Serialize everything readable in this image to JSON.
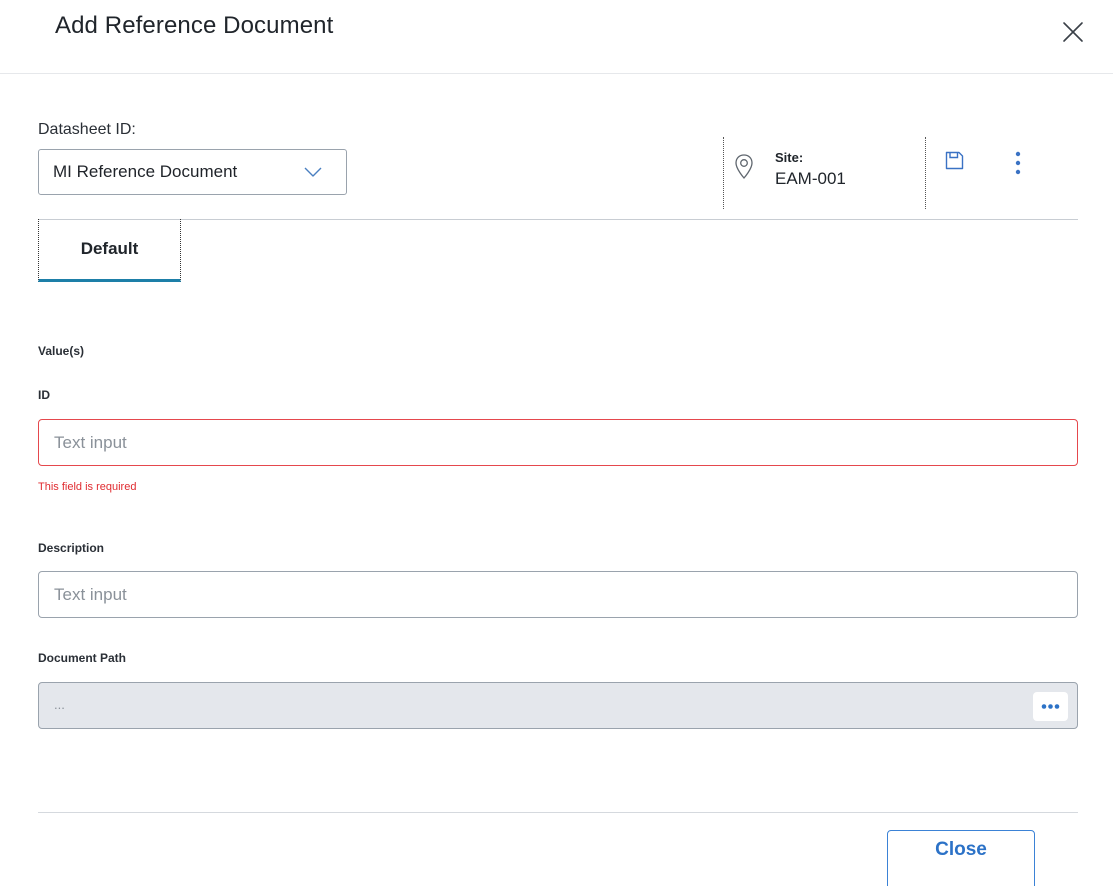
{
  "dialog": {
    "title": "Add Reference Document"
  },
  "datasheet": {
    "label": "Datasheet ID:",
    "selected": "MI Reference Document"
  },
  "site": {
    "label": "Site:",
    "value": "EAM-001"
  },
  "tabs": [
    {
      "label": "Default",
      "active": true
    }
  ],
  "form": {
    "section_label": "Value(s)",
    "fields": {
      "id": {
        "label": "ID",
        "value": "",
        "placeholder": "Text input",
        "error": "This field is required"
      },
      "description": {
        "label": "Description",
        "value": "",
        "placeholder": "Text input"
      },
      "document_path": {
        "label": "Document Path",
        "value": "..."
      }
    }
  },
  "footer": {
    "close_label": "Close"
  },
  "colors": {
    "accent": "#2c72c7",
    "tab_underline": "#1d7fa8",
    "error": "#e02b30",
    "disabled_field_bg": "#e4e7ec"
  },
  "icons": {
    "dialog_close": "close-x-icon",
    "select_chevron": "chevron-down-icon",
    "site": "map-pin-icon",
    "save": "save-icon",
    "more": "more-vertical-icon",
    "browse": "more-horizontal-icon"
  }
}
